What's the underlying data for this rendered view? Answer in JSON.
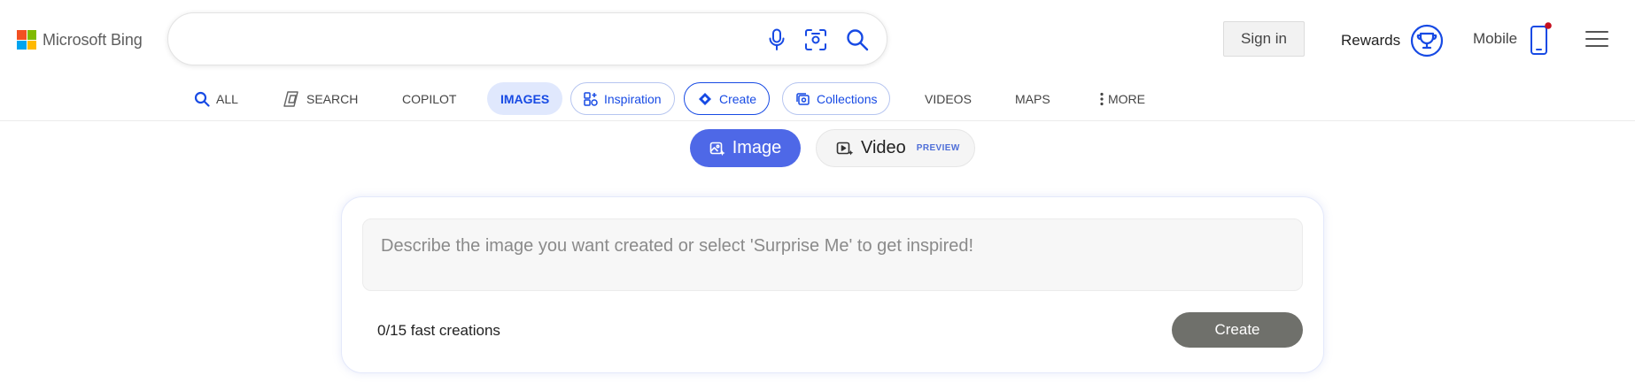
{
  "header": {
    "logo_text": "Microsoft Bing",
    "logo_colors": [
      "#f25022",
      "#7fba00",
      "#00a4ef",
      "#ffb900"
    ],
    "search": {
      "value": "",
      "placeholder": ""
    },
    "icons": {
      "mic": "microphone-icon",
      "visual_search": "visual-search-icon",
      "search": "search-icon"
    },
    "sign_in_label": "Sign in",
    "rewards_label": "Rewards",
    "mobile_label": "Mobile",
    "notification_color": "#c50f1f",
    "accent": "#174ae4"
  },
  "nav": {
    "items": [
      {
        "label": "ALL",
        "icon": "search-icon"
      },
      {
        "label": "SEARCH",
        "icon": "copilot-search-icon"
      },
      {
        "label": "COPILOT"
      },
      {
        "label": "IMAGES",
        "active": true
      },
      {
        "label": "Inspiration",
        "icon": "inspiration-icon"
      },
      {
        "label": "Create",
        "icon": "create-icon"
      },
      {
        "label": "Collections",
        "icon": "collections-icon"
      },
      {
        "label": "VIDEOS"
      },
      {
        "label": "MAPS"
      },
      {
        "label": "MORE",
        "icon": "more-vertical-icon"
      }
    ]
  },
  "mode_toggle": {
    "image_label": "Image",
    "video_label": "Video",
    "video_tag": "PREVIEW",
    "active": "Image",
    "active_color": "#4e68e7"
  },
  "creator": {
    "prompt_placeholder": "Describe the image you want created or select 'Surprise Me' to get inspired!",
    "prompt_value": "",
    "fast_creations": "0/15 fast creations",
    "create_label": "Create",
    "create_color": "#6f706b"
  }
}
